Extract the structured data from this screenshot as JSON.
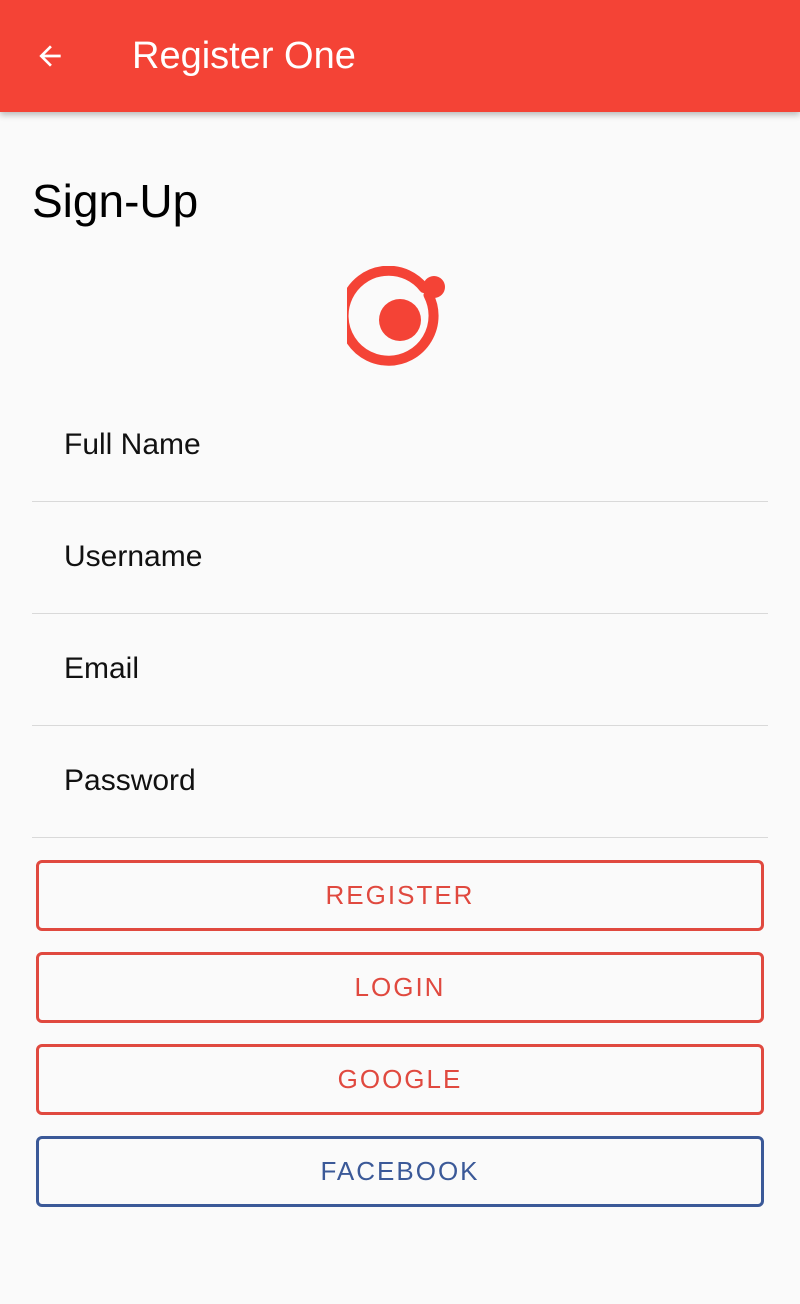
{
  "header": {
    "title": "Register One"
  },
  "page": {
    "heading": "Sign-Up"
  },
  "form": {
    "full_name_placeholder": "Full Name",
    "username_placeholder": "Username",
    "email_placeholder": "Email",
    "password_placeholder": "Password"
  },
  "buttons": {
    "register": "REGISTER",
    "login": "LOGIN",
    "google": "GOOGLE",
    "facebook": "FACEBOOK"
  },
  "colors": {
    "primary": "#f44336",
    "button_accent": "#e0493f",
    "facebook": "#3b5998",
    "background": "#fafafa"
  },
  "icons": {
    "back": "arrow-back-icon",
    "logo": "ionic-logo-icon"
  }
}
